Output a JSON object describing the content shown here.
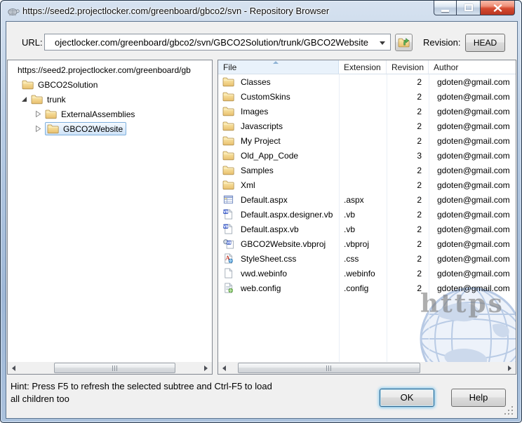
{
  "colors": {
    "titlebar_gradient_top": "#d6e2f0",
    "titlebar_gradient_bottom": "#9fb8d7",
    "close_button_red": "#c13a24",
    "selection_border": "#7fb0dd",
    "selection_fill": "#cee3f8",
    "sorted_column_bg": "#e9f2fb",
    "focus_glow_blue": "#6fc1ec",
    "folder_yellow": "#efc982",
    "watermark_gray": "#7d7d7d"
  },
  "titlebar": {
    "title": "https://seed2.projectlocker.com/greenboard/gbco2/svn - Repository Browser"
  },
  "toolbar": {
    "url_label": "URL:",
    "url_value": "ojectlocker.com/greenboard/gbco2/svn/GBCO2Solution/trunk/GBCO2Website",
    "revision_label": "Revision:",
    "revision_button": "HEAD"
  },
  "tree": {
    "root_label": "https://seed2.projectlocker.com/greenboard/gb",
    "items": [
      {
        "label": "GBCO2Solution",
        "state": "none"
      },
      {
        "label": "trunk",
        "state": "expanded"
      },
      {
        "label": "ExternalAssemblies",
        "state": "collapsed"
      },
      {
        "label": "GBCO2Website",
        "state": "collapsed",
        "selected": true
      }
    ]
  },
  "list": {
    "columns": [
      {
        "label": "File"
      },
      {
        "label": "Extension"
      },
      {
        "label": "Revision"
      },
      {
        "label": "Author"
      }
    ],
    "sort_column": "File",
    "sort_direction": "ascending",
    "rows": [
      {
        "name": "Classes",
        "ext": "",
        "rev": "2",
        "author": "gdoten@gmail.com"
      },
      {
        "name": "CustomSkins",
        "ext": "",
        "rev": "2",
        "author": "gdoten@gmail.com"
      },
      {
        "name": "Images",
        "ext": "",
        "rev": "2",
        "author": "gdoten@gmail.com"
      },
      {
        "name": "Javascripts",
        "ext": "",
        "rev": "2",
        "author": "gdoten@gmail.com"
      },
      {
        "name": "My Project",
        "ext": "",
        "rev": "2",
        "author": "gdoten@gmail.com"
      },
      {
        "name": "Old_App_Code",
        "ext": "",
        "rev": "3",
        "author": "gdoten@gmail.com"
      },
      {
        "name": "Samples",
        "ext": "",
        "rev": "2",
        "author": "gdoten@gmail.com"
      },
      {
        "name": "Xml",
        "ext": "",
        "rev": "2",
        "author": "gdoten@gmail.com"
      },
      {
        "name": "Default.aspx",
        "ext": ".aspx",
        "rev": "2",
        "author": "gdoten@gmail.com"
      },
      {
        "name": "Default.aspx.designer.vb",
        "ext": ".vb",
        "rev": "2",
        "author": "gdoten@gmail.com"
      },
      {
        "name": "Default.aspx.vb",
        "ext": ".vb",
        "rev": "2",
        "author": "gdoten@gmail.com"
      },
      {
        "name": "GBCO2Website.vbproj",
        "ext": ".vbproj",
        "rev": "2",
        "author": "gdoten@gmail.com"
      },
      {
        "name": "StyleSheet.css",
        "ext": ".css",
        "rev": "2",
        "author": "gdoten@gmail.com"
      },
      {
        "name": "vwd.webinfo",
        "ext": ".webinfo",
        "rev": "2",
        "author": "gdoten@gmail.com"
      },
      {
        "name": "web.config",
        "ext": ".config",
        "rev": "2",
        "author": "gdoten@gmail.com"
      }
    ],
    "watermark_text": "https"
  },
  "footer": {
    "hint_line1": "Hint: Press F5 to refresh the selected subtree and Ctrl-F5 to load",
    "hint_line2": "all children too",
    "ok_label": "OK",
    "help_label": "Help"
  }
}
